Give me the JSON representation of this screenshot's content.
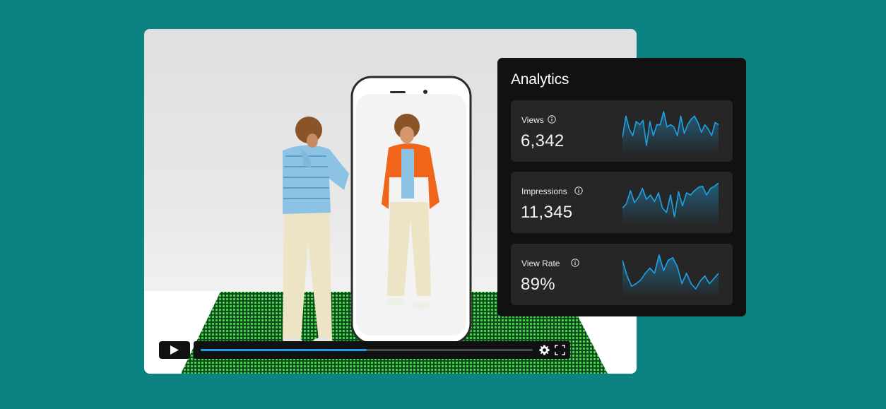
{
  "player": {
    "progress_fraction": 0.5,
    "icons": {
      "play": "play-icon",
      "settings": "gear-icon",
      "fullscreen": "fullscreen-icon"
    },
    "accent_color": "#1e9bf0"
  },
  "analytics": {
    "title": "Analytics",
    "metrics": [
      {
        "label": "Views",
        "value": "6,342",
        "icon": "info-icon",
        "trend": [
          10,
          30,
          18,
          12,
          25,
          22,
          26,
          3,
          25,
          12,
          22,
          22,
          34,
          20,
          22,
          20,
          12,
          30,
          14,
          22,
          27,
          30,
          24,
          15,
          22,
          18,
          12,
          24,
          22
        ]
      },
      {
        "label": "Impressions",
        "value": "11,345",
        "icon": "info-icon",
        "trend": [
          10,
          14,
          26,
          15,
          20,
          28,
          18,
          22,
          16,
          24,
          10,
          6,
          22,
          2,
          25,
          12,
          24,
          22,
          26,
          29,
          30,
          22,
          28,
          30,
          33
        ]
      },
      {
        "label": "View Rate",
        "value": "89%",
        "icon": "info-icon",
        "trend": [
          30,
          18,
          10,
          12,
          15,
          20,
          24,
          20,
          34,
          22,
          30,
          32,
          25,
          12,
          20,
          12,
          8,
          14,
          18,
          12,
          16,
          20
        ]
      }
    ],
    "sparkline_color": "#1ea2e6"
  }
}
